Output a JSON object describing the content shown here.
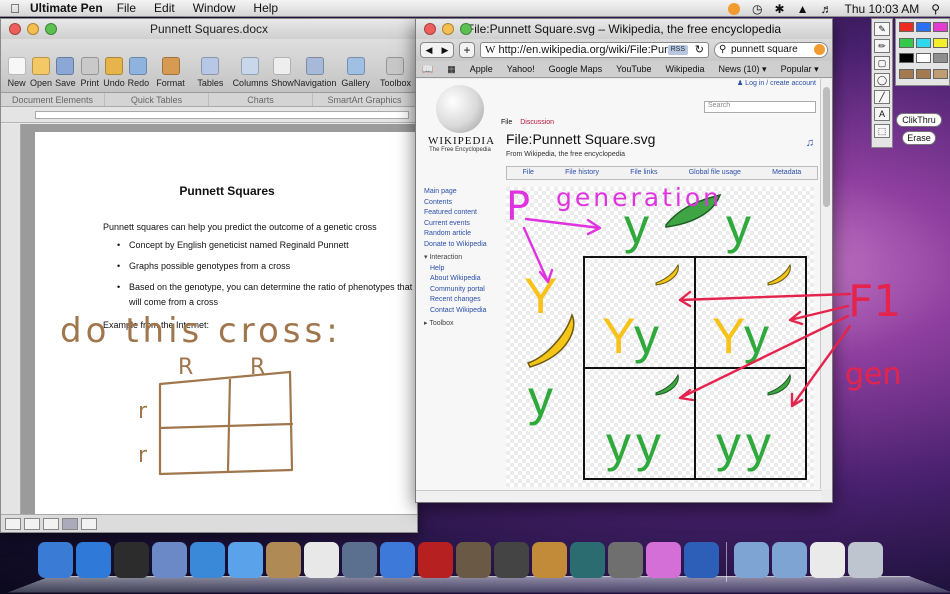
{
  "menubar": {
    "app": "Ultimate Pen",
    "items": [
      "File",
      "Edit",
      "Window",
      "Help"
    ],
    "clock": "Thu 10:03 AM"
  },
  "word": {
    "title": "Punnett Squares.docx",
    "toolbar": [
      {
        "label": "New",
        "color": "#f7f7f7"
      },
      {
        "label": "Open",
        "color": "#f3c865"
      },
      {
        "label": "Save",
        "color": "#8aa7d6"
      },
      {
        "label": "Print",
        "color": "#c9c9c9"
      },
      {
        "label": "Undo",
        "color": "#e7b44c"
      },
      {
        "label": "Redo",
        "color": "#8fb3df"
      },
      {
        "label": "Format",
        "color": "#d69a52"
      },
      {
        "label": "Tables",
        "color": "#b7c8e6"
      },
      {
        "label": "Columns",
        "color": "#c9d7ea"
      },
      {
        "label": "Show",
        "color": "#eeeeee"
      },
      {
        "label": "Navigation",
        "color": "#a7b9d8"
      },
      {
        "label": "Gallery",
        "color": "#9fbfe3"
      },
      {
        "label": "Toolbox",
        "color": "#c8c8c8"
      }
    ],
    "ribbon": [
      "Document Elements",
      "Quick Tables",
      "Charts",
      "SmartArt Graphics"
    ],
    "doc": {
      "title": "Punnett Squares",
      "intro": "Punnett squares can help you predict the outcome of a genetic cross",
      "bullets": [
        "Concept by English geneticist named Reginald Punnett",
        "Graphs possible genotypes from a cross",
        "Based on the genotype, you can determine the ratio of phenotypes that will come from a cross"
      ],
      "example": "Example from the Internet:"
    }
  },
  "browser": {
    "title": "File:Punnett Square.svg – Wikipedia, the free encyclopedia",
    "url": "http://en.wikipedia.org/wiki/File:Pun",
    "rss": "RSS",
    "search_query": "punnett square",
    "bookmarks": [
      "Apple",
      "Yahoo!",
      "Google Maps",
      "YouTube",
      "Wikipedia",
      "News (10) ▾",
      "Popular ▾"
    ],
    "wiki": {
      "wordmark": "WIKIPEDIA",
      "tagline": "The Free Encyclopedia",
      "tabs": [
        "File",
        "Discussion"
      ],
      "login": "Log in / create account",
      "search_placeholder": "Search",
      "heading": "File:Punnett Square.svg",
      "from": "From Wikipedia, the free encyclopedia",
      "file_tabs": [
        "File",
        "File history",
        "File links",
        "Global file usage",
        "Metadata"
      ],
      "nav": [
        "Main page",
        "Contents",
        "Featured content",
        "Current events",
        "Random article",
        "Donate to Wikipedia"
      ],
      "interaction_header": "Interaction",
      "interaction": [
        "Help",
        "About Wikipedia",
        "Community portal",
        "Recent changes",
        "Contact Wikipedia"
      ],
      "toolbox": "Toolbox"
    },
    "punnett": {
      "top": [
        "y",
        "y"
      ],
      "left": [
        "Y",
        "y"
      ],
      "cells": [
        [
          "Y",
          "y",
          "Y",
          "y"
        ],
        [
          "y",
          "y",
          "y",
          "y"
        ]
      ],
      "yellow": "#f7c21a",
      "green": "#2fa83c"
    }
  },
  "palette": {
    "colors": [
      "#ee2b22",
      "#2b6ff7",
      "#e43bd1",
      "#35c94b",
      "#2fd8ea",
      "#f4ef2a",
      "#000000",
      "#ffffff",
      "#8e8e8e",
      "#a47a4f",
      "#a47a4f",
      "#c09c73"
    ],
    "clickthru": "ClikThru",
    "erase": "Erase"
  },
  "annotations": {
    "magenta": "#e033e0",
    "red": "#e4244c",
    "brown": "#a0764c",
    "p_label": "P",
    "generation": "generation",
    "f1": "F1",
    "gen": "gen",
    "do_cross": "do this cross:",
    "r_top": [
      "R",
      "R"
    ],
    "r_left": [
      "r",
      "r"
    ]
  },
  "dock": [
    {
      "name": "finder-icon",
      "color": "#3a7bd5"
    },
    {
      "name": "app-store-icon",
      "color": "#2f79d8"
    },
    {
      "name": "dashboard-icon",
      "color": "#2c2c2c"
    },
    {
      "name": "mail-icon",
      "color": "#6b89c6"
    },
    {
      "name": "safari-icon",
      "color": "#3a88d8"
    },
    {
      "name": "ichat-icon",
      "color": "#5aa3ea"
    },
    {
      "name": "address-book-icon",
      "color": "#b08a55"
    },
    {
      "name": "ical-icon",
      "color": "#e8e8e8"
    },
    {
      "name": "preview-icon",
      "color": "#5b6f8f"
    },
    {
      "name": "itunes-icon",
      "color": "#3d79d8"
    },
    {
      "name": "photo-booth-icon",
      "color": "#b72020"
    },
    {
      "name": "iphoto-icon",
      "color": "#6a5a45"
    },
    {
      "name": "imovie-icon",
      "color": "#444444"
    },
    {
      "name": "garageband-icon",
      "color": "#c18b3a"
    },
    {
      "name": "time-machine-icon",
      "color": "#2a6c70"
    },
    {
      "name": "system-preferences-icon",
      "color": "#6f6f6f"
    },
    {
      "name": "ultimate-pen-icon",
      "color": "#d46fd8"
    },
    {
      "name": "word-icon",
      "color": "#2d5fb8"
    },
    {
      "name": "applications-folder-icon",
      "color": "#7ea4d4"
    },
    {
      "name": "documents-folder-icon",
      "color": "#7ea4d4"
    },
    {
      "name": "downloads-stack-icon",
      "color": "#eaeaea"
    },
    {
      "name": "trash-icon",
      "color": "#bfc5cf"
    }
  ]
}
